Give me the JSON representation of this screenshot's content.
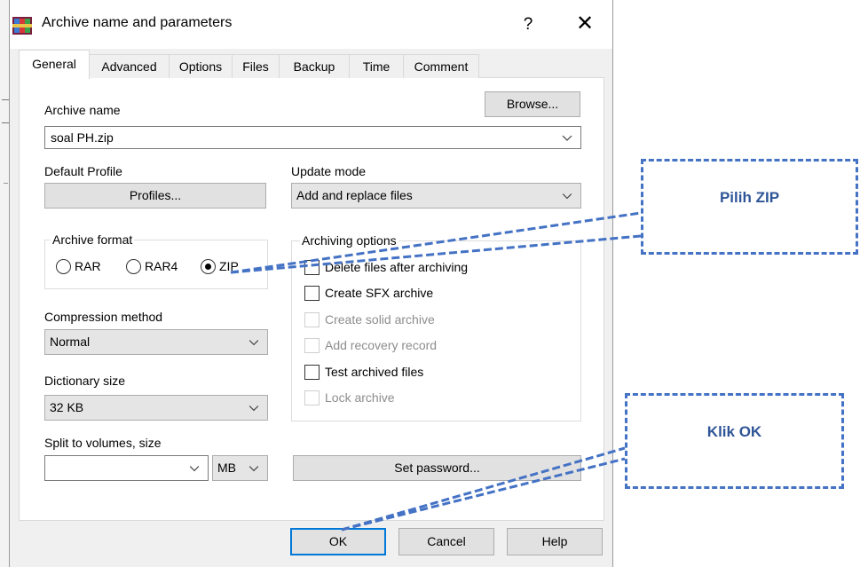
{
  "window": {
    "title": "Archive name and parameters",
    "help_glyph": "?",
    "close_glyph": "✕"
  },
  "tabs": [
    "General",
    "Advanced",
    "Options",
    "Files",
    "Backup",
    "Time",
    "Comment"
  ],
  "archive_name": {
    "label": "Archive name",
    "value": "soal PH.zip",
    "browse_label": "Browse..."
  },
  "default_profile": {
    "label": "Default Profile",
    "button_label": "Profiles..."
  },
  "update_mode": {
    "label": "Update mode",
    "value": "Add and replace files"
  },
  "archive_format": {
    "label": "Archive format",
    "options": [
      "RAR",
      "RAR4",
      "ZIP"
    ],
    "selected": "ZIP"
  },
  "compression_method": {
    "label": "Compression method",
    "value": "Normal"
  },
  "dictionary_size": {
    "label": "Dictionary size",
    "value": "32 KB"
  },
  "split_volumes": {
    "label": "Split to volumes, size",
    "value": "",
    "unit": "MB"
  },
  "archiving_options": {
    "label": "Archiving options",
    "items": [
      {
        "label": "Delete files after archiving",
        "checked": false,
        "enabled": true
      },
      {
        "label": "Create SFX archive",
        "checked": false,
        "enabled": true
      },
      {
        "label": "Create solid archive",
        "checked": false,
        "enabled": false
      },
      {
        "label": "Add recovery record",
        "checked": false,
        "enabled": false
      },
      {
        "label": "Test archived files",
        "checked": false,
        "enabled": true
      },
      {
        "label": "Lock archive",
        "checked": false,
        "enabled": false
      }
    ]
  },
  "set_password_label": "Set password...",
  "buttons": {
    "ok": "OK",
    "cancel": "Cancel",
    "help": "Help"
  },
  "annotations": {
    "pilih_zip": "Pilih ZIP",
    "klik_ok": "Klik OK"
  },
  "colors": {
    "annotation": "#4472c4",
    "annotation_text": "#2f5597",
    "focus": "#0078d7"
  }
}
